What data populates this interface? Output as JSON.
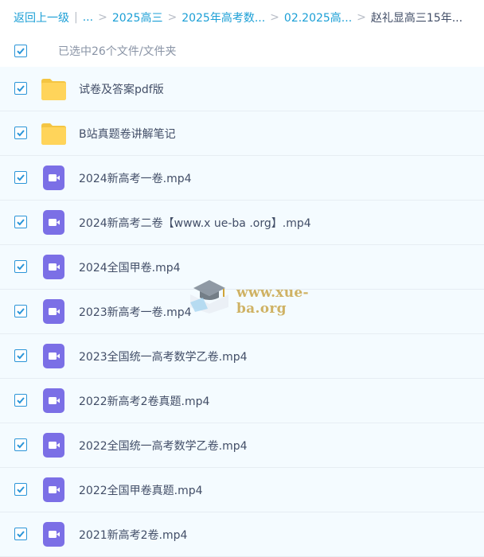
{
  "breadcrumb": {
    "back_label": "返回上一级",
    "divider": "|",
    "ellipsis": "...",
    "items": [
      "2025高三",
      "2025年高考数...",
      "02.2025高...",
      "赵礼显高三15年..."
    ]
  },
  "selection": {
    "text": "已选中26个文件/文件夹",
    "checked": true
  },
  "files": [
    {
      "name": "试卷及答案pdf版",
      "type": "folder",
      "checked": true
    },
    {
      "name": "B站真题卷讲解笔记",
      "type": "folder",
      "checked": true
    },
    {
      "name": "2024新高考一卷.mp4",
      "type": "video",
      "checked": true
    },
    {
      "name": "2024新高考二卷【www.x ue-ba .org】.mp4",
      "type": "video",
      "checked": true
    },
    {
      "name": "2024全国甲卷.mp4",
      "type": "video",
      "checked": true
    },
    {
      "name": "2023新高考一卷.mp4",
      "type": "video",
      "checked": true
    },
    {
      "name": "2023全国统一高考数学乙卷.mp4",
      "type": "video",
      "checked": true
    },
    {
      "name": "2022新高考2卷真题.mp4",
      "type": "video",
      "checked": true
    },
    {
      "name": "2022全国统一高考数学乙卷.mp4",
      "type": "video",
      "checked": true
    },
    {
      "name": "2022全国甲卷真题.mp4",
      "type": "video",
      "checked": true
    },
    {
      "name": "2021新高考2卷.mp4",
      "type": "video",
      "checked": true
    }
  ],
  "icons": {
    "folder": "folder-icon",
    "video": "video-file-icon",
    "check": "checkmark-icon"
  },
  "colors": {
    "link": "#1b9fd6",
    "folder": "#ffd45a",
    "video": "#7b6fe6",
    "row_bg": "#f4fbff",
    "checkbox": "#2b95d8"
  },
  "watermark": {
    "text": "www.xue-ba.org"
  }
}
